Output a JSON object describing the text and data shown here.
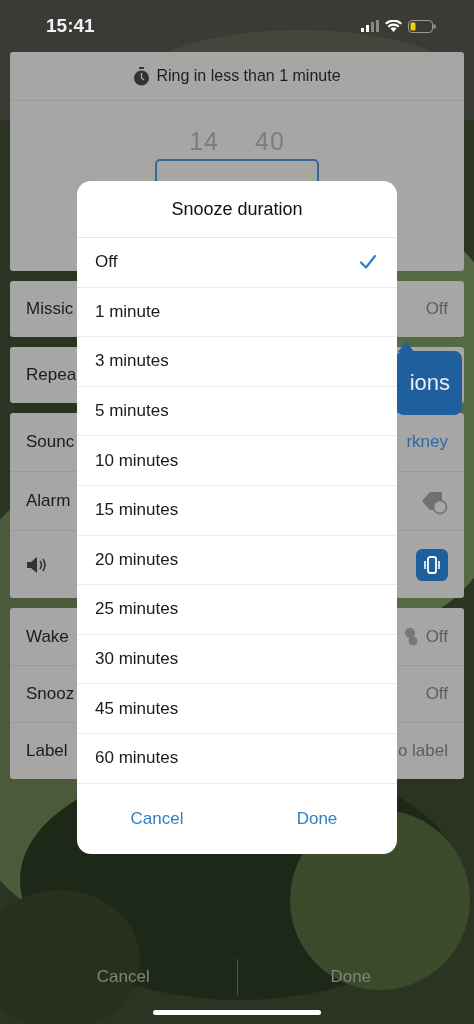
{
  "status_bar": {
    "time": "15:41"
  },
  "alarm_card": {
    "countdown": "Ring in less than 1 minute",
    "previous_hour": "14",
    "previous_minute": "40"
  },
  "cards": [
    {
      "rows": [
        {
          "kind": "value",
          "label": "Missic",
          "value": "Off"
        }
      ]
    },
    {
      "rows": [
        {
          "kind": "tooltip",
          "label": "Repea",
          "tooltip": "ions"
        }
      ]
    },
    {
      "rows": [
        {
          "kind": "link",
          "label": "Sounc",
          "value": "rkney"
        },
        {
          "kind": "icons",
          "label": "Alarm"
        },
        {
          "kind": "volume"
        }
      ]
    },
    {
      "rows": [
        {
          "kind": "icon-value",
          "label": "Wake",
          "value": "Off"
        },
        {
          "kind": "value",
          "label": "Snooz",
          "value": "Off"
        },
        {
          "kind": "value",
          "label": "Label",
          "value": "o label"
        }
      ]
    }
  ],
  "bottom_bar": {
    "cancel": "Cancel",
    "done": "Done"
  },
  "dialog": {
    "title": "Snooze duration",
    "options": [
      {
        "label": "Off",
        "selected": true
      },
      {
        "label": "1 minute",
        "selected": false
      },
      {
        "label": "3 minutes",
        "selected": false
      },
      {
        "label": "5 minutes",
        "selected": false
      },
      {
        "label": "10 minutes",
        "selected": false
      },
      {
        "label": "15 minutes",
        "selected": false
      },
      {
        "label": "20 minutes",
        "selected": false
      },
      {
        "label": "25 minutes",
        "selected": false
      },
      {
        "label": "30 minutes",
        "selected": false
      },
      {
        "label": "45 minutes",
        "selected": false
      },
      {
        "label": "60 minutes",
        "selected": false
      }
    ],
    "cancel": "Cancel",
    "done": "Done"
  }
}
